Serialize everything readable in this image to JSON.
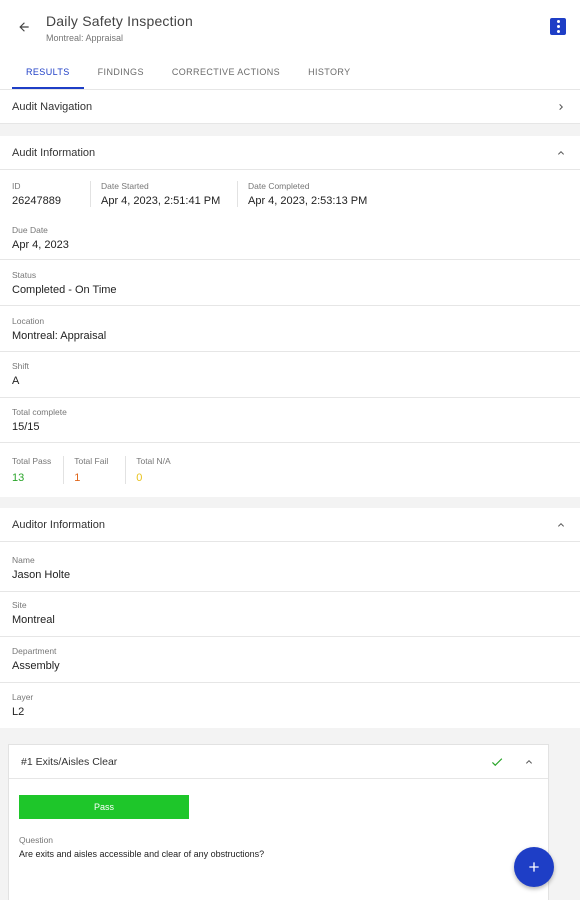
{
  "header": {
    "title": "Daily Safety Inspection",
    "subtitle": "Montreal: Appraisal",
    "back_icon": "arrow-left-icon",
    "menu_icon": "more-vert-icon"
  },
  "tabs": [
    {
      "label": "RESULTS",
      "active": true
    },
    {
      "label": "FINDINGS",
      "active": false
    },
    {
      "label": "CORRECTIVE ACTIONS",
      "active": false
    },
    {
      "label": "HISTORY",
      "active": false
    }
  ],
  "audit_navigation": {
    "title": "Audit Navigation"
  },
  "audit_information": {
    "title": "Audit Information",
    "id_label": "ID",
    "id_value": "26247889",
    "date_started_label": "Date Started",
    "date_started_value": "Apr 4, 2023, 2:51:41 PM",
    "date_completed_label": "Date Completed",
    "date_completed_value": "Apr 4, 2023, 2:53:13 PM",
    "due_date_label": "Due Date",
    "due_date_value": "Apr 4, 2023",
    "status_label": "Status",
    "status_value": "Completed - On Time",
    "location_label": "Location",
    "location_value": "Montreal: Appraisal",
    "shift_label": "Shift",
    "shift_value": "A",
    "total_complete_label": "Total complete",
    "total_complete_value": "15/15",
    "total_pass_label": "Total Pass",
    "total_pass_value": "13",
    "total_fail_label": "Total Fail",
    "total_fail_value": "1",
    "total_na_label": "Total N/A",
    "total_na_value": "0"
  },
  "auditor_information": {
    "title": "Auditor Information",
    "name_label": "Name",
    "name_value": "Jason Holte",
    "site_label": "Site",
    "site_value": "Montreal",
    "department_label": "Department",
    "department_value": "Assembly",
    "layer_label": "Layer",
    "layer_value": "L2"
  },
  "question_card": {
    "title": "#1 Exits/Aisles Clear",
    "result_label": "Pass",
    "question_label": "Question",
    "question_text": "Are exits and aisles accessible and clear of any obstructions?"
  },
  "colors": {
    "accent": "#1e3ec6",
    "pass": "#2aa52a",
    "fail": "#e0661b",
    "na": "#e8c21c",
    "pass_button": "#1ec62a"
  }
}
